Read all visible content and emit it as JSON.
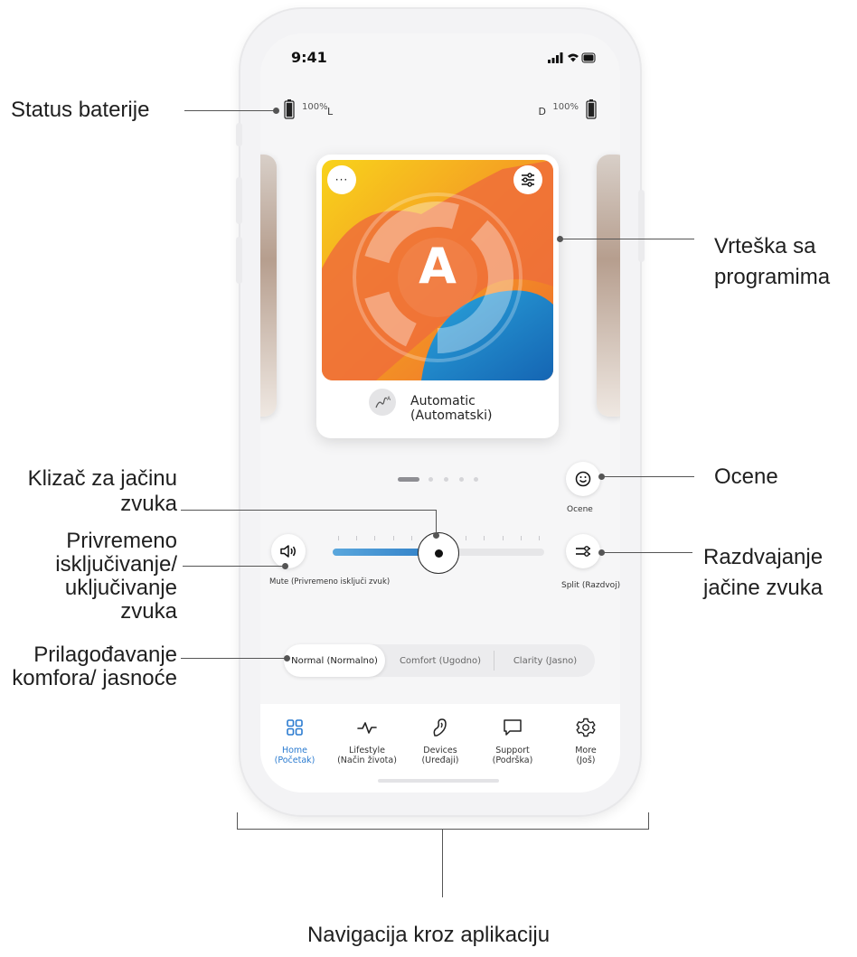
{
  "status_bar": {
    "time": "9:41"
  },
  "battery": {
    "left_pct": "100%",
    "left_side": "L",
    "right_pct": "100%",
    "right_side": "D"
  },
  "program_card": {
    "letter": "A",
    "name": "Automatic (Automatski)",
    "colors": {
      "yellow": "#f6c31a",
      "orange": "#f2752c",
      "blue": "#1f84c9"
    }
  },
  "carousel": {
    "page_count": 5,
    "active_page": 1
  },
  "rating": {
    "label": "Ocene"
  },
  "volume": {
    "mute_label": "Mute (Privremeno isključi zvuk)",
    "split_label": "Split (Razdvoj)",
    "level": 0.5
  },
  "comfort_clarity": {
    "options": [
      "Normal (Normalno)",
      "Comfort (Ugodno)",
      "Clarity (Jasno)"
    ],
    "selected": "Normal (Normalno)"
  },
  "nav": {
    "items": [
      {
        "label": "Home\n(Početak)",
        "icon": "home-grid-icon",
        "active": true
      },
      {
        "label": "Lifestyle\n(Način života)",
        "icon": "pulse-icon",
        "active": false
      },
      {
        "label": "Devices\n(Uređaji)",
        "icon": "hearing-aid-icon",
        "active": false
      },
      {
        "label": "Support\n(Podrška)",
        "icon": "chat-bubble-icon",
        "active": false
      },
      {
        "label": "More\n(Još)",
        "icon": "gear-icon",
        "active": false
      }
    ],
    "active_color": "#2b7bd0"
  },
  "annotations": {
    "battery_status": "Status baterije",
    "program_carousel": "Vrteška sa programima",
    "volume_slider": "Klizač za jačinu zvuka",
    "mute_toggle": "Privremeno isključivanje/ uključivanje zvuka",
    "comfort_clarity": "Prilagođavanje komfora/ jasnoće",
    "ratings": "Ocene",
    "volume_split": "Razdvajanje jačine zvuka",
    "app_navigation": "Navigacija kroz aplikaciju"
  }
}
